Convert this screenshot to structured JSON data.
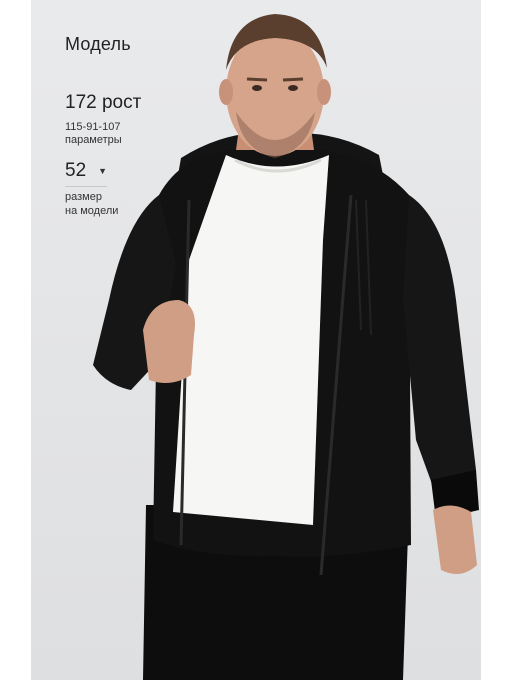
{
  "model": {
    "title": "Модель",
    "height": "172 рост",
    "params_value": "115-91-107",
    "params_label": "параметры",
    "size_value": "52",
    "size_caret": "▼",
    "size_label_1": "размер",
    "size_label_2": "на модели"
  },
  "colors": {
    "background": "#e6e7e9",
    "hoodie": "#111111",
    "tshirt": "#f6f6f4",
    "skin": "#d6a48a"
  },
  "icons": {
    "size_dropdown": "chevron-down-icon"
  }
}
